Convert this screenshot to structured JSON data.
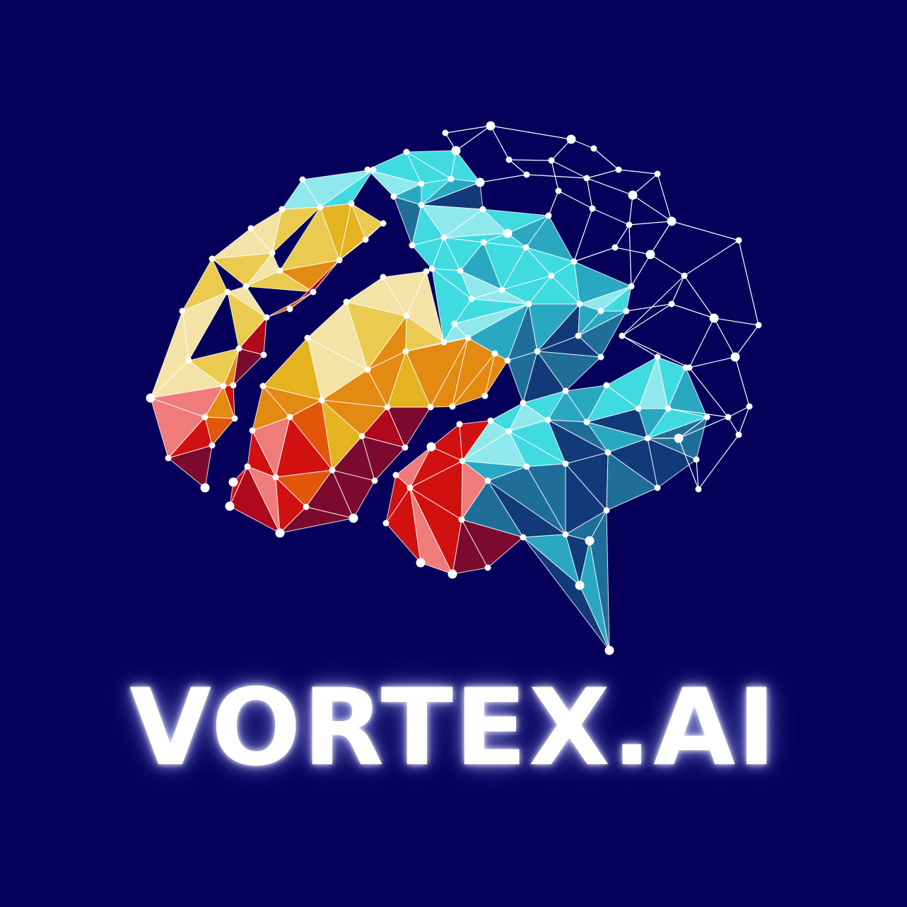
{
  "brand": {
    "name": "VORTEX.AI"
  },
  "logo": {
    "icon": "polygonal-brain-icon"
  },
  "colors": {
    "background": "#06005a",
    "node": "#ffffff",
    "edge": "#ffffff",
    "cyan_light": "#8fe9ec",
    "cyan": "#3fdbe0",
    "teal": "#2aa8c2",
    "blue": "#1f6e9a",
    "navy": "#123a78",
    "yellow_light": "#f4e3a6",
    "yellow": "#eacb4f",
    "gold": "#e3b320",
    "orange": "#e38a12",
    "orange_red": "#e2560a",
    "red": "#d11010",
    "crimson": "#b0081d",
    "maroon": "#7b0a2e",
    "salmon": "#ef7b7b"
  }
}
